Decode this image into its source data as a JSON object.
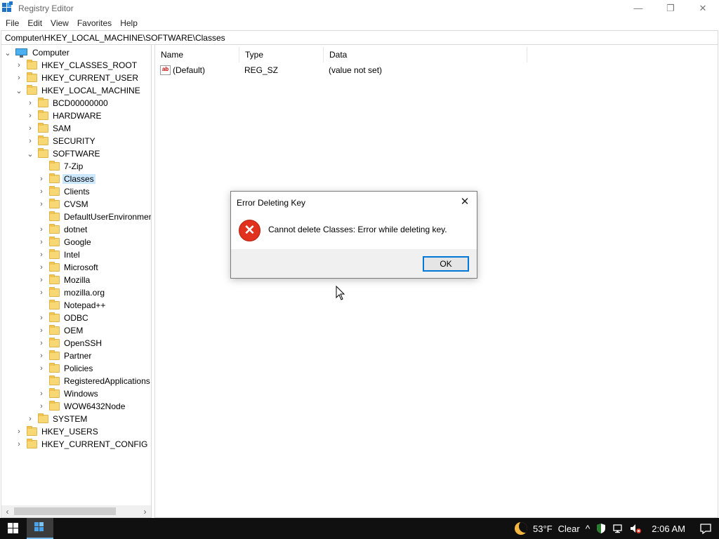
{
  "window": {
    "title": "Registry Editor",
    "minimize_glyph": "—",
    "maximize_glyph": "❐",
    "close_glyph": "✕"
  },
  "menu": {
    "items": [
      "File",
      "Edit",
      "View",
      "Favorites",
      "Help"
    ]
  },
  "address": {
    "path": "Computer\\HKEY_LOCAL_MACHINE\\SOFTWARE\\Classes"
  },
  "tree": {
    "root": "Computer",
    "items": [
      {
        "label": "HKEY_CLASSES_ROOT",
        "chevron": "›"
      },
      {
        "label": "HKEY_CURRENT_USER",
        "chevron": "›"
      },
      {
        "label": "HKEY_LOCAL_MACHINE",
        "chevron": "⌄"
      },
      {
        "label": "BCD00000000",
        "chevron": "›"
      },
      {
        "label": "HARDWARE",
        "chevron": "›"
      },
      {
        "label": "SAM",
        "chevron": "›"
      },
      {
        "label": "SECURITY",
        "chevron": "›"
      },
      {
        "label": "SOFTWARE",
        "chevron": "⌄"
      },
      {
        "label": "7-Zip",
        "chevron": ""
      },
      {
        "label": "Classes",
        "chevron": "›",
        "selected": true
      },
      {
        "label": "Clients",
        "chevron": "›"
      },
      {
        "label": "CVSM",
        "chevron": "›"
      },
      {
        "label": "DefaultUserEnvironmen",
        "chevron": ""
      },
      {
        "label": "dotnet",
        "chevron": "›"
      },
      {
        "label": "Google",
        "chevron": "›"
      },
      {
        "label": "Intel",
        "chevron": "›"
      },
      {
        "label": "Microsoft",
        "chevron": "›"
      },
      {
        "label": "Mozilla",
        "chevron": "›"
      },
      {
        "label": "mozilla.org",
        "chevron": "›"
      },
      {
        "label": "Notepad++",
        "chevron": ""
      },
      {
        "label": "ODBC",
        "chevron": "›"
      },
      {
        "label": "OEM",
        "chevron": "›"
      },
      {
        "label": "OpenSSH",
        "chevron": "›"
      },
      {
        "label": "Partner",
        "chevron": "›"
      },
      {
        "label": "Policies",
        "chevron": "›"
      },
      {
        "label": "RegisteredApplications",
        "chevron": ""
      },
      {
        "label": "Windows",
        "chevron": "›"
      },
      {
        "label": "WOW6432Node",
        "chevron": "›"
      },
      {
        "label": "SYSTEM",
        "chevron": "›"
      },
      {
        "label": "HKEY_USERS",
        "chevron": "›"
      },
      {
        "label": "HKEY_CURRENT_CONFIG",
        "chevron": "›"
      }
    ],
    "root_chevron": "⌄",
    "scroll_left": "‹",
    "scroll_right": "›"
  },
  "list": {
    "columns": [
      "Name",
      "Type",
      "Data"
    ],
    "rows": [
      {
        "icon_text": "ab",
        "name": "(Default)",
        "type": "REG_SZ",
        "data": "(value not set)"
      }
    ]
  },
  "dialog": {
    "title": "Error Deleting Key",
    "close_glyph": "✕",
    "error_glyph": "✕",
    "message": "Cannot delete Classes:  Error while deleting key.",
    "ok_label": "OK"
  },
  "taskbar": {
    "weather_temp": "53°F",
    "weather_text": "Clear",
    "chevron_glyph": "^",
    "time": "2:06 AM",
    "notification_glyph": "▭"
  },
  "colors": {
    "accent": "#0078d7",
    "selection": "#cce8ff",
    "error_red": "#e0321f",
    "folder": "#f8d775",
    "taskbar": "#101010"
  }
}
